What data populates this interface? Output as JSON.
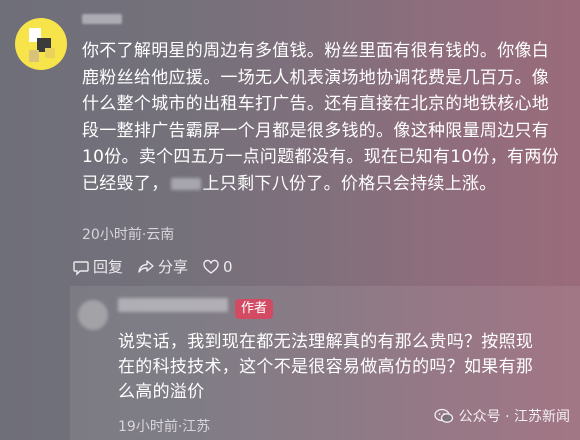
{
  "main_comment": {
    "lines": [
      "你不了解明星的周边有多值钱。粉丝里面有很有钱的。你像白",
      "鹿粉丝给他应援。一场无人机表演场地协调花费是几百万。像",
      "什么整个城市的出租车打广告。还有直接在北京的地铁核心地",
      "段一整排广告霸屏一个月都是很多钱的。像这种限量周边只有",
      "10份。卖个四五万一点问题都没有。现在已知有10份，有两份",
      "已经毁了，",
      "上只剩下八份了。价格只会持续上涨。"
    ],
    "meta": "20小时前·云南",
    "actions": {
      "reply_label": "回复",
      "share_label": "分享",
      "like_count": "0"
    }
  },
  "reply_comment": {
    "badge": "作者",
    "lines": [
      "说实话，我到现在都无法理解真的有那么贵吗？按照现",
      "在的科技技术，这个不是很容易做高仿的吗？如果有那",
      "么高的溢价"
    ],
    "meta": "19小时前·江苏"
  },
  "watermark": {
    "text": "公众号 · 江苏新闻"
  },
  "icons": [
    "avatar",
    "reply-icon",
    "share-icon",
    "heart-icon",
    "wechat-icon"
  ]
}
